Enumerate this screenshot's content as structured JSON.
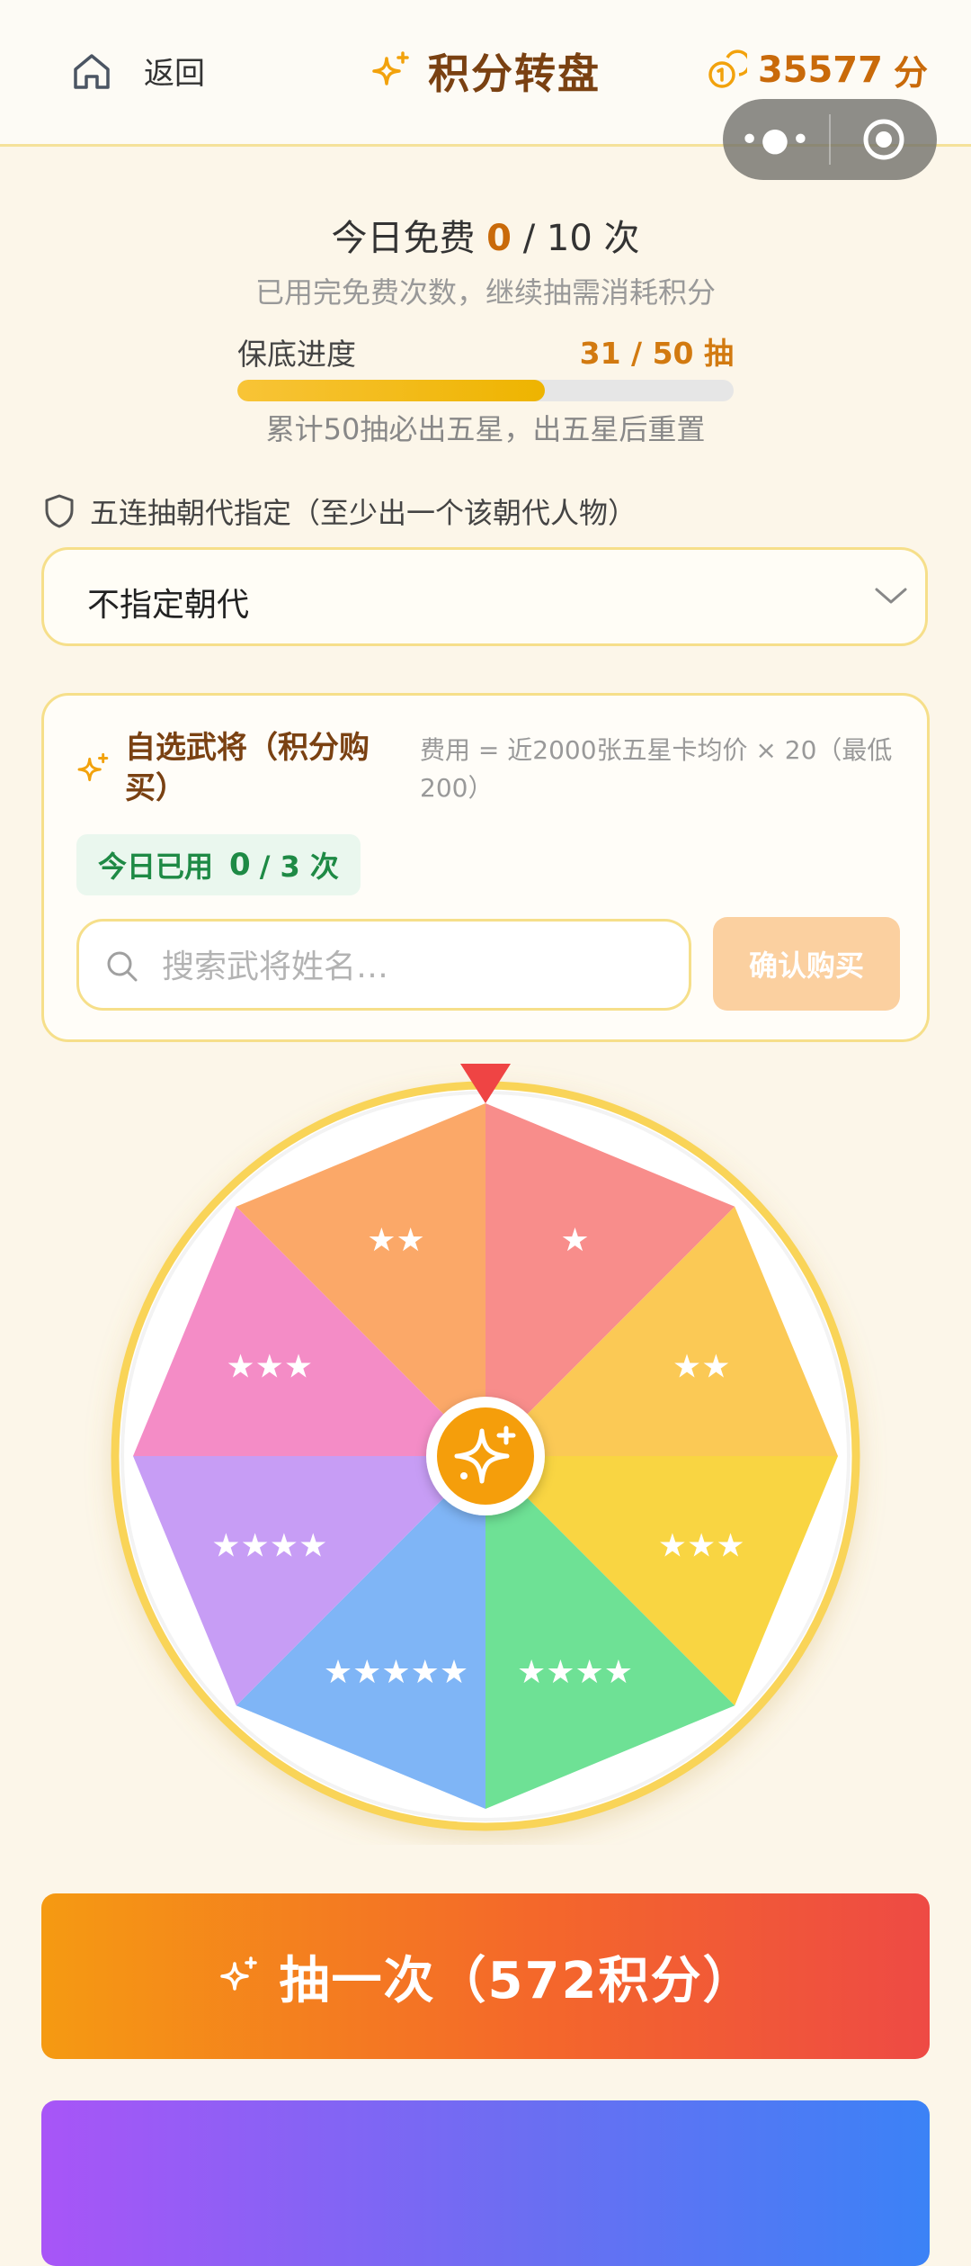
{
  "header": {
    "back_label": "返回",
    "title": "积分转盘",
    "points": "35577",
    "points_unit": "分"
  },
  "free_draws": {
    "prefix": "今日免费",
    "used": "0",
    "rest": "/ 10 次",
    "note": "已用完免费次数，继续抽需消耗积分"
  },
  "pity": {
    "label": "保底进度",
    "count": "31 / 50 抽",
    "progress": 0.62,
    "note": "累计50抽必出五星，出五星后重置"
  },
  "dynasty": {
    "label": "五连抽朝代指定（至少出一个该朝代人物）",
    "selected": "不指定朝代"
  },
  "custom_general": {
    "title": "自选武将（积分购买）",
    "fee": "费用 = 近2000张五星卡均价 × 20（最低200）",
    "used_prefix": "今日已用",
    "used_num": "0",
    "used_suffix": "/ 3 次",
    "search_placeholder": "搜索武将姓名…",
    "buy_label": "确认购买"
  },
  "wheel": {
    "segments": [
      {
        "stars": "★",
        "color": "#f88d8b"
      },
      {
        "stars": "★★",
        "color": "#fbc955"
      },
      {
        "stars": "★★★",
        "color": "#f9d542"
      },
      {
        "stars": "★★★★",
        "color": "#6ee195"
      },
      {
        "stars": "★★★★★",
        "color": "#7fb5f6"
      },
      {
        "stars": "★★★★",
        "color": "#c79df5"
      },
      {
        "stars": "★★★",
        "color": "#f48cc6"
      },
      {
        "stars": "★★",
        "color": "#fba868"
      }
    ],
    "rim_color": "#f9d458",
    "pointer_color": "#ef4444",
    "hub_color": "#f59e0b"
  },
  "actions": {
    "draw_once": "抽一次（572积分）"
  }
}
